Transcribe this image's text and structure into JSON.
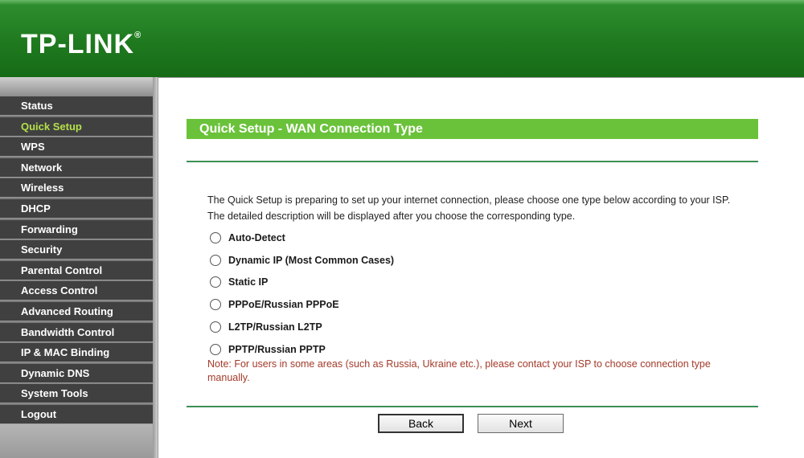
{
  "brand": {
    "logo_text": "TP-LINK",
    "registered_mark": "®",
    "accent": "#6ac23a"
  },
  "sidebar": {
    "items": [
      {
        "label": "Status",
        "active": false
      },
      {
        "label": "Quick Setup",
        "active": true
      },
      {
        "label": "WPS",
        "active": false
      },
      {
        "label": "Network",
        "active": false
      },
      {
        "label": "Wireless",
        "active": false
      },
      {
        "label": "DHCP",
        "active": false
      },
      {
        "label": "Forwarding",
        "active": false
      },
      {
        "label": "Security",
        "active": false
      },
      {
        "label": "Parental Control",
        "active": false
      },
      {
        "label": "Access Control",
        "active": false
      },
      {
        "label": "Advanced Routing",
        "active": false
      },
      {
        "label": "Bandwidth Control",
        "active": false
      },
      {
        "label": "IP & MAC Binding",
        "active": false
      },
      {
        "label": "Dynamic DNS",
        "active": false
      },
      {
        "label": "System Tools",
        "active": false
      },
      {
        "label": "Logout",
        "active": false
      }
    ]
  },
  "main": {
    "title": "Quick Setup - WAN Connection Type",
    "description_line1": "The Quick Setup is preparing to set up your internet connection, please choose one type below according to your ISP.",
    "description_line2": "The detailed description will be displayed after you choose the corresponding type.",
    "options": [
      {
        "label": "Auto-Detect",
        "checked": false
      },
      {
        "label": "Dynamic IP (Most Common Cases)",
        "checked": false
      },
      {
        "label": "Static IP",
        "checked": false
      },
      {
        "label": "PPPoE/Russian PPPoE",
        "checked": false
      },
      {
        "label": "L2TP/Russian L2TP",
        "checked": false
      },
      {
        "label": "PPTP/Russian PPTP",
        "checked": false
      }
    ],
    "note": "Note: For users in some areas (such as Russia, Ukraine etc.), please contact your ISP to choose connection type manually.",
    "back_label": "Back",
    "next_label": "Next"
  }
}
